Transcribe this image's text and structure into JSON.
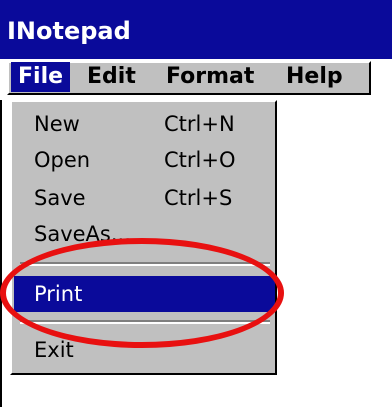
{
  "window": {
    "title": "INotepad"
  },
  "menubar": {
    "items": [
      {
        "label": "File"
      },
      {
        "label": "Edit"
      },
      {
        "label": "Format"
      },
      {
        "label": "Help"
      }
    ]
  },
  "file_menu": {
    "items": [
      {
        "label": "New",
        "shortcut": "Ctrl+N"
      },
      {
        "label": "Open",
        "shortcut": "Ctrl+O"
      },
      {
        "label": "Save",
        "shortcut": "Ctrl+S"
      },
      {
        "label": "SaveAs...",
        "shortcut": ""
      },
      {
        "label": "Print",
        "shortcut": ""
      },
      {
        "label": "Exit",
        "shortcut": ""
      }
    ]
  },
  "colors": {
    "titlebar": "#0a0a9a",
    "menu_bg": "#c0c0c0",
    "highlight": "#0a0a9a",
    "annotation": "#e81010"
  }
}
